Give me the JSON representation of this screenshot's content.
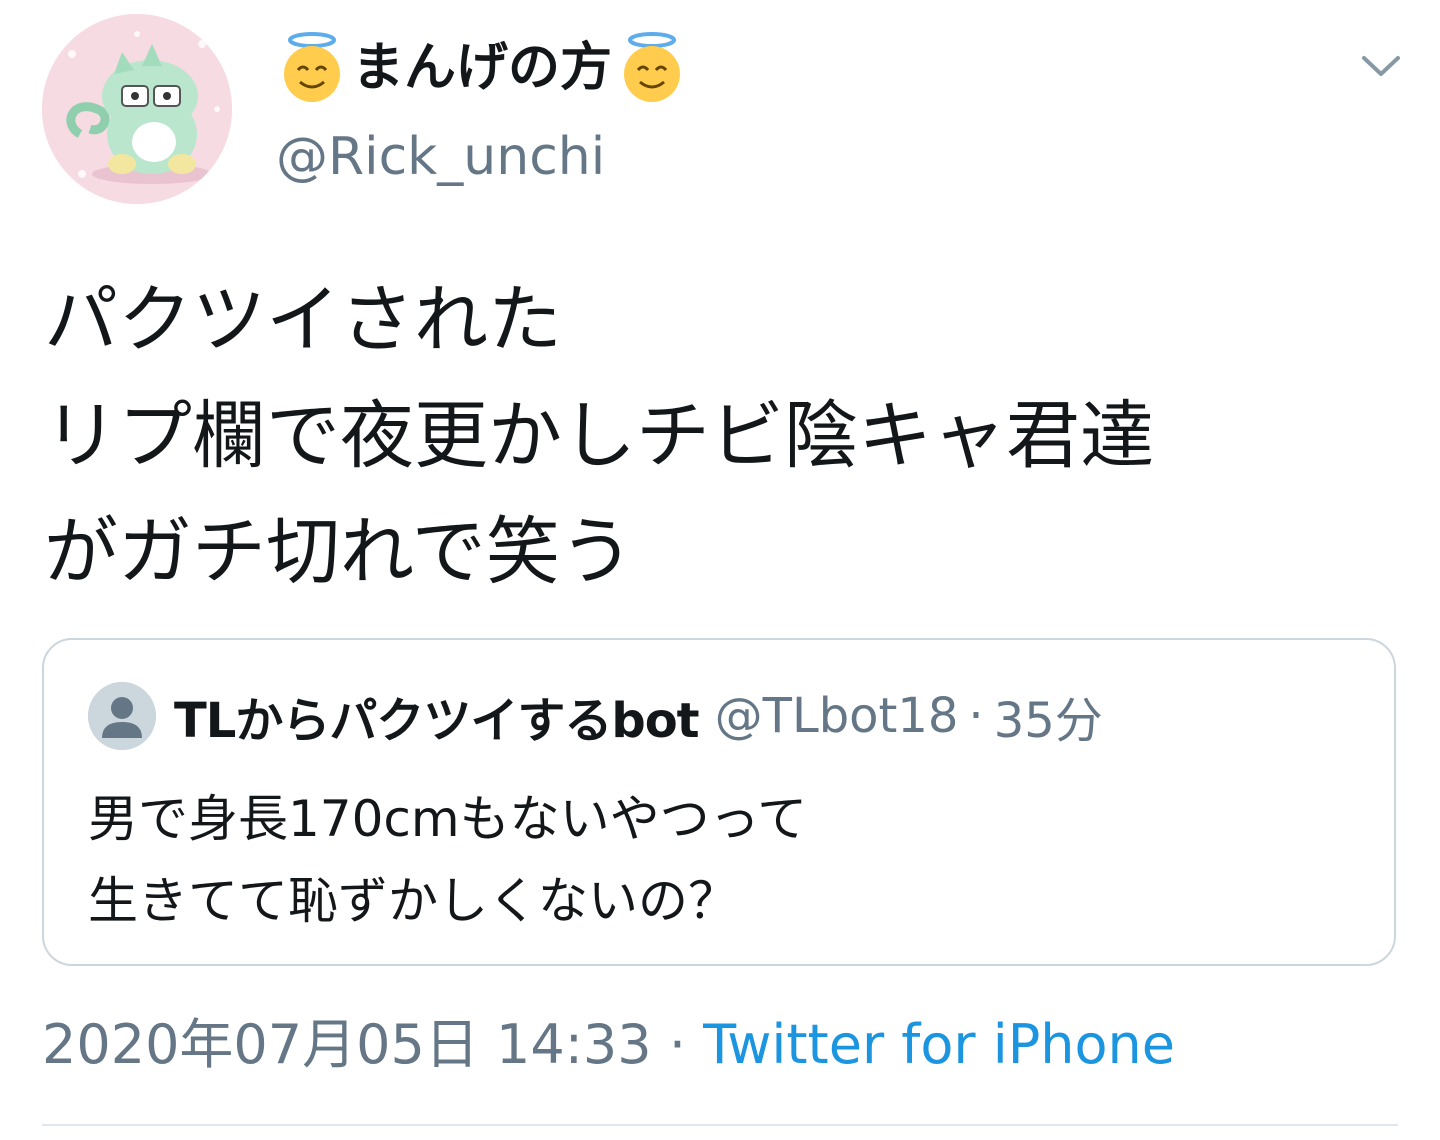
{
  "author": {
    "display_name": "まんげの方",
    "emoji_left": "smiling-face-with-halo",
    "emoji_right": "smiling-face-with-halo",
    "handle": "@Rick_unchi"
  },
  "tweet": {
    "lines": [
      "パクツイされた",
      "リプ欄で夜更かしチビ陰キャ君達",
      "がガチ切れで笑う"
    ]
  },
  "quoted_tweet": {
    "name": "TLからパクツイするbot",
    "handle": "@TLbot18",
    "separator": "·",
    "time": "35分",
    "lines": [
      "男で身長170cmもないやつって",
      "生きてて恥ずかしくないの？"
    ]
  },
  "meta": {
    "timestamp": "2020年07月05日 14:33",
    "separator": "·",
    "source": "Twitter for iPhone"
  },
  "colors": {
    "text": "#14171a",
    "secondary": "#657786",
    "link": "#1b95e0",
    "border": "#ccd6dd"
  }
}
